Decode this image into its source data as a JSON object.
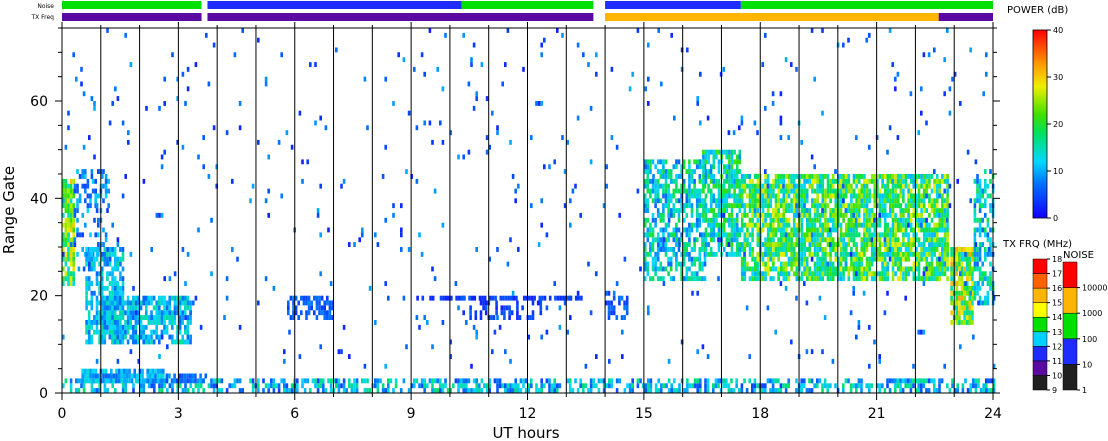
{
  "chart_data": {
    "type": "heatmap",
    "title": "",
    "xlabel": "UT hours",
    "ylabel": "Range Gate",
    "xlim": [
      0,
      24
    ],
    "ylim": [
      0,
      75
    ],
    "x_ticks": [
      0,
      3,
      6,
      9,
      12,
      15,
      18,
      21,
      24
    ],
    "x_tick_labels": [
      "0",
      "3",
      "6",
      "9",
      "12",
      "15",
      "18",
      "21",
      "24"
    ],
    "y_ticks": [
      0,
      20,
      40,
      60
    ],
    "y_tick_labels": [
      "0",
      "20",
      "40",
      "60"
    ],
    "vertical_lines_hours": [
      1,
      2,
      3,
      4,
      5,
      6,
      7,
      8,
      9,
      10,
      11,
      12,
      13,
      14,
      15,
      16,
      17,
      18,
      19,
      20,
      21,
      22,
      23
    ],
    "noise_bar_label": "Noise",
    "txfreq_bar_label": "TX Freq",
    "noise_bar": [
      {
        "start": 0.0,
        "end": 3.6,
        "color": "#00e000"
      },
      {
        "start": 3.6,
        "end": 3.75,
        "color": "#ffffff"
      },
      {
        "start": 3.75,
        "end": 10.3,
        "color": "#1e2cff"
      },
      {
        "start": 10.3,
        "end": 13.7,
        "color": "#00e000"
      },
      {
        "start": 13.7,
        "end": 14.0,
        "color": "#ffffff"
      },
      {
        "start": 14.0,
        "end": 17.5,
        "color": "#1e2cff"
      },
      {
        "start": 17.5,
        "end": 24.0,
        "color": "#00e000"
      }
    ],
    "txfreq_bar": [
      {
        "start": 0.0,
        "end": 3.6,
        "color": "#5a0aa0"
      },
      {
        "start": 3.6,
        "end": 3.75,
        "color": "#ffffff"
      },
      {
        "start": 3.75,
        "end": 13.7,
        "color": "#5a0aa0"
      },
      {
        "start": 13.7,
        "end": 14.0,
        "color": "#ffffff"
      },
      {
        "start": 14.0,
        "end": 22.6,
        "color": "#ffb400"
      },
      {
        "start": 22.6,
        "end": 24.0,
        "color": "#5a0aa0"
      }
    ],
    "power_scale": {
      "label": "POWER (dB)",
      "range": [
        0,
        40
      ],
      "ticks": [
        0,
        10,
        20,
        30,
        40
      ],
      "tick_labels": [
        "0",
        "10",
        "20",
        "30",
        "40"
      ]
    },
    "txfreq_scale": {
      "label": "TX FRQ (MHz)",
      "ticks": [
        9,
        10,
        11,
        12,
        13,
        14,
        15,
        16,
        17,
        18
      ],
      "tick_labels": [
        "9",
        "10",
        "11",
        "12",
        "13",
        "14",
        "15",
        "16",
        "17",
        "18"
      ],
      "colors": [
        "#202020",
        "#5a0aa0",
        "#1e2cff",
        "#00d0ff",
        "#00e000",
        "#ffff00",
        "#ffb400",
        "#ff6000",
        "#ff0000"
      ]
    },
    "noise_scale": {
      "label": "NOISE",
      "ticks": [
        1,
        10,
        100,
        1000,
        10000
      ],
      "tick_labels": [
        "1",
        "10",
        "100",
        "1000",
        "10000"
      ],
      "colors": [
        "#202020",
        "#1e2cff",
        "#00e000",
        "#ffb400",
        "#ff0000"
      ]
    },
    "echo_regions": [
      {
        "t0": 0.0,
        "t1": 24.0,
        "g0": 0,
        "g1": 3,
        "density": 0.55,
        "power": [
          4,
          18
        ]
      },
      {
        "t0": 0.5,
        "t1": 2.6,
        "g0": 2,
        "g1": 5,
        "density": 0.9,
        "power": [
          6,
          14
        ]
      },
      {
        "t0": 2.6,
        "t1": 3.7,
        "g0": 2,
        "g1": 4,
        "density": 0.85,
        "power": [
          4,
          10
        ]
      },
      {
        "t0": 0.0,
        "t1": 0.3,
        "g0": 22,
        "g1": 44,
        "density": 0.85,
        "power": [
          12,
          30
        ]
      },
      {
        "t0": 0.3,
        "t1": 1.2,
        "g0": 28,
        "g1": 46,
        "density": 0.35,
        "power": [
          4,
          12
        ]
      },
      {
        "t0": 0.6,
        "t1": 1.6,
        "g0": 10,
        "g1": 30,
        "density": 0.7,
        "power": [
          6,
          16
        ]
      },
      {
        "t0": 1.0,
        "t1": 3.3,
        "g0": 10,
        "g1": 20,
        "density": 0.75,
        "power": [
          6,
          16
        ]
      },
      {
        "t0": 5.8,
        "t1": 7.0,
        "g0": 15,
        "g1": 20,
        "density": 0.6,
        "power": [
          3,
          8
        ]
      },
      {
        "t0": 9.0,
        "t1": 13.4,
        "g0": 19,
        "g1": 20,
        "density": 0.7,
        "power": [
          2,
          6
        ]
      },
      {
        "t0": 10.5,
        "t1": 12.5,
        "g0": 15,
        "g1": 19,
        "density": 0.35,
        "power": [
          2,
          6
        ]
      },
      {
        "t0": 14.0,
        "t1": 14.6,
        "g0": 15,
        "g1": 21,
        "density": 0.45,
        "power": [
          3,
          8
        ]
      },
      {
        "t0": 15.0,
        "t1": 16.6,
        "g0": 23,
        "g1": 48,
        "density": 0.6,
        "power": [
          6,
          20
        ]
      },
      {
        "t0": 16.5,
        "t1": 17.5,
        "g0": 28,
        "g1": 50,
        "density": 0.7,
        "power": [
          8,
          22
        ]
      },
      {
        "t0": 17.5,
        "t1": 22.8,
        "g0": 23,
        "g1": 45,
        "density": 0.8,
        "power": [
          10,
          28
        ]
      },
      {
        "t0": 22.9,
        "t1": 23.5,
        "g0": 14,
        "g1": 30,
        "density": 0.85,
        "power": [
          12,
          32
        ]
      },
      {
        "t0": 23.5,
        "t1": 24.0,
        "g0": 18,
        "g1": 46,
        "density": 0.6,
        "power": [
          6,
          20
        ]
      },
      {
        "t0": 0.0,
        "t1": 24.0,
        "g0": 5,
        "g1": 75,
        "density": 0.02,
        "power": [
          2,
          10
        ]
      }
    ]
  }
}
